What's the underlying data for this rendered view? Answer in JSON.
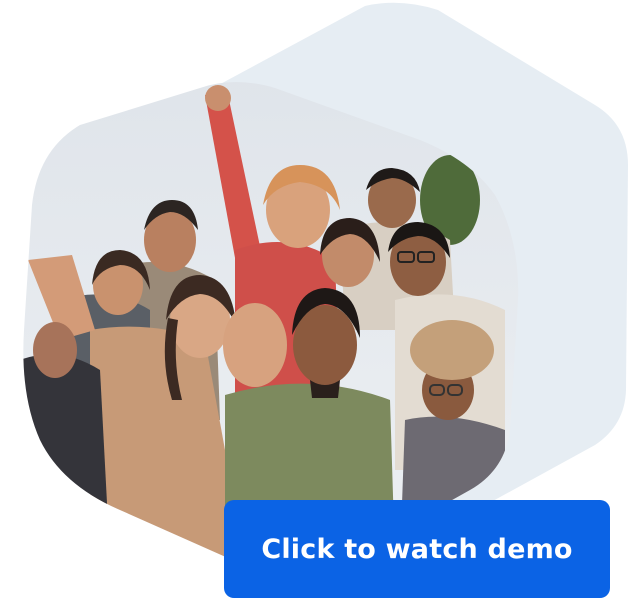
{
  "cta": {
    "label": "Click to watch demo",
    "background": "#0b63e5",
    "text_color": "#ffffff"
  },
  "decor": {
    "background_hexagon_color": "#e6edf3"
  },
  "image": {
    "subject": "group-photo"
  }
}
